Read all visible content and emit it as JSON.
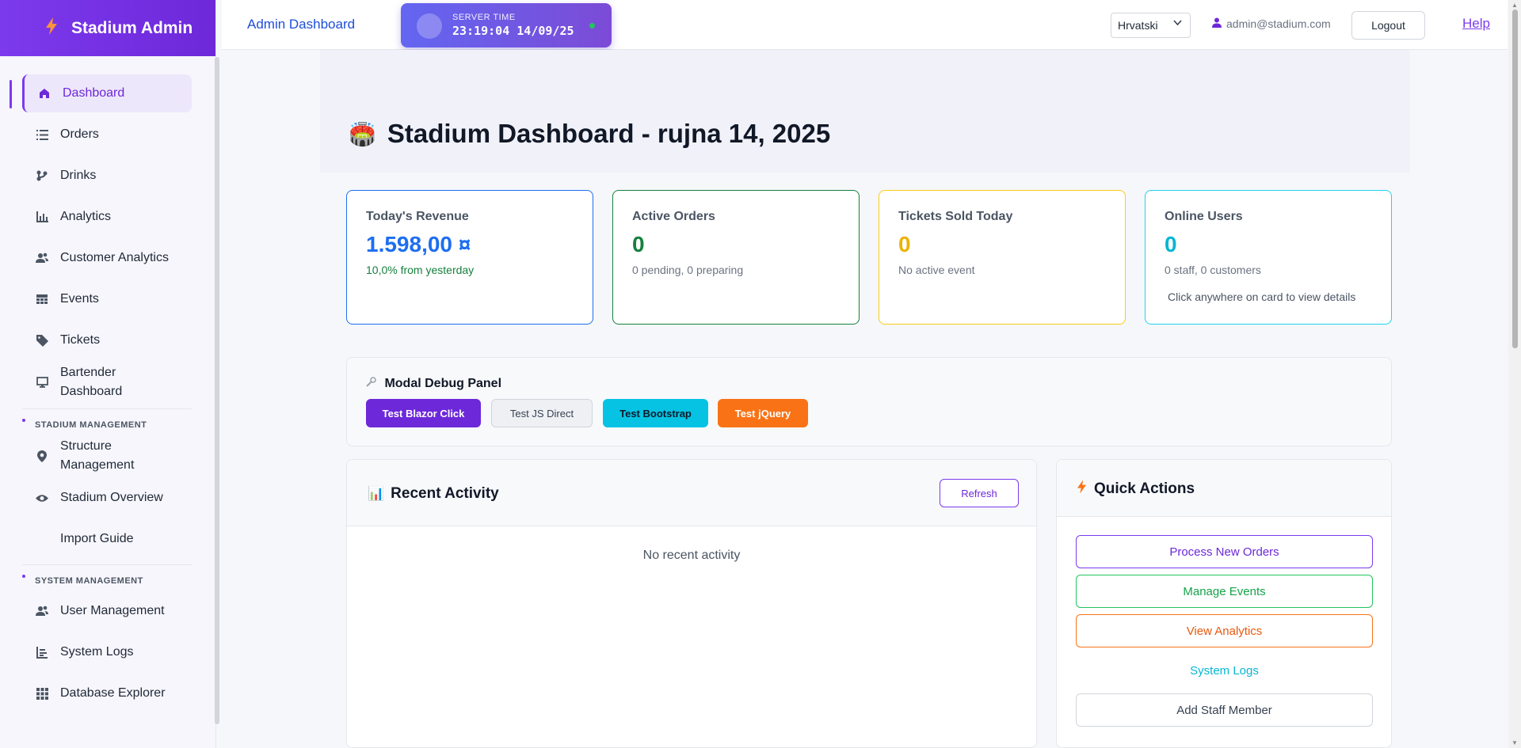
{
  "brand": {
    "title": "Stadium Admin",
    "icon": "bolt-icon"
  },
  "topbar": {
    "title": "Admin Dashboard",
    "server_time_label": "SERVER TIME",
    "server_time_value": "23:19:04 14/09/25",
    "language": "Hrvatski",
    "user_email": "admin@stadium.com",
    "logout_label": "Logout",
    "help_label": "Help"
  },
  "sidebar": {
    "items": [
      {
        "label": "Dashboard",
        "icon": "home-icon"
      },
      {
        "label": "Orders",
        "icon": "list-icon"
      },
      {
        "label": "Drinks",
        "icon": "drink-icon"
      },
      {
        "label": "Analytics",
        "icon": "bar-chart-icon"
      },
      {
        "label": "Customer Analytics",
        "icon": "users-icon"
      },
      {
        "label": "Events",
        "icon": "calendar-icon"
      },
      {
        "label": "Tickets",
        "icon": "tag-icon"
      },
      {
        "label": "Bartender Dashboard",
        "icon": "monitor-icon"
      }
    ],
    "section1_label": "STADIUM MANAGEMENT",
    "section1_items": [
      {
        "label": "Structure Management",
        "icon": "map-pin-icon"
      },
      {
        "label": "Stadium Overview",
        "icon": "eye-icon"
      },
      {
        "label": "Import Guide",
        "icon": ""
      }
    ],
    "section2_label": "SYSTEM MANAGEMENT",
    "section2_items": [
      {
        "label": "User Management",
        "icon": "users-icon"
      },
      {
        "label": "System Logs",
        "icon": "log-icon"
      },
      {
        "label": "Database Explorer",
        "icon": "grid-icon"
      }
    ]
  },
  "page": {
    "emoji": "🏟️",
    "title": "Stadium Dashboard - rujna 14, 2025"
  },
  "stats": [
    {
      "label": "Today's Revenue",
      "value": "1.598,00 ¤",
      "sub": "10,0% from yesterday",
      "color": "#1d6ef0"
    },
    {
      "label": "Active Orders",
      "value": "0",
      "sub": "0 pending, 0 preparing",
      "color": "#15803d"
    },
    {
      "label": "Tickets Sold Today",
      "value": "0",
      "sub": "No active event",
      "color": "#eab308"
    },
    {
      "label": "Online Users",
      "value": "0",
      "sub": "0 staff, 0 customers",
      "hint": "Click anywhere on card to view details",
      "color": "#06b6d4"
    }
  ],
  "debug": {
    "title": "Modal Debug Panel",
    "icon": "wrench-icon",
    "buttons": [
      "Test Blazor Click",
      "Test JS Direct",
      "Test Bootstrap",
      "Test jQuery"
    ]
  },
  "activity": {
    "emoji": "📊",
    "title": "Recent Activity",
    "refresh_label": "Refresh",
    "empty_text": "No recent activity"
  },
  "quick_actions": {
    "title": "Quick Actions",
    "icon": "bolt-icon",
    "buttons": [
      "Process New Orders",
      "Manage Events",
      "View Analytics",
      "System Logs",
      "Add Staff Member"
    ]
  },
  "colors": {
    "accent": "#7c3aed",
    "primary": "#1d6ef0",
    "success": "#22c55e",
    "warning": "#f97316",
    "info": "#06b6d4"
  }
}
